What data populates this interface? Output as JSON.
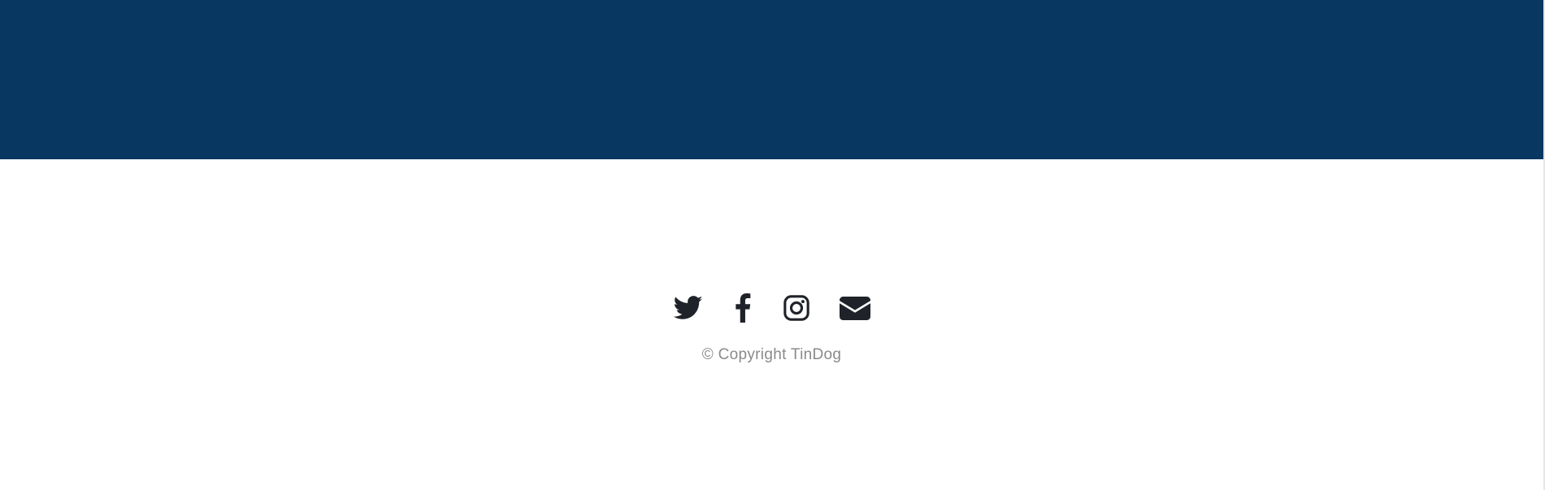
{
  "colors": {
    "band": "#083762",
    "icon": "#1f2329",
    "copyright_text": "#8a8a8a"
  },
  "footer": {
    "social": [
      {
        "name": "twitter",
        "icon": "twitter-icon"
      },
      {
        "name": "facebook",
        "icon": "facebook-icon"
      },
      {
        "name": "instagram",
        "icon": "instagram-icon"
      },
      {
        "name": "email",
        "icon": "envelope-icon"
      }
    ],
    "copyright": "© Copyright TinDog"
  }
}
